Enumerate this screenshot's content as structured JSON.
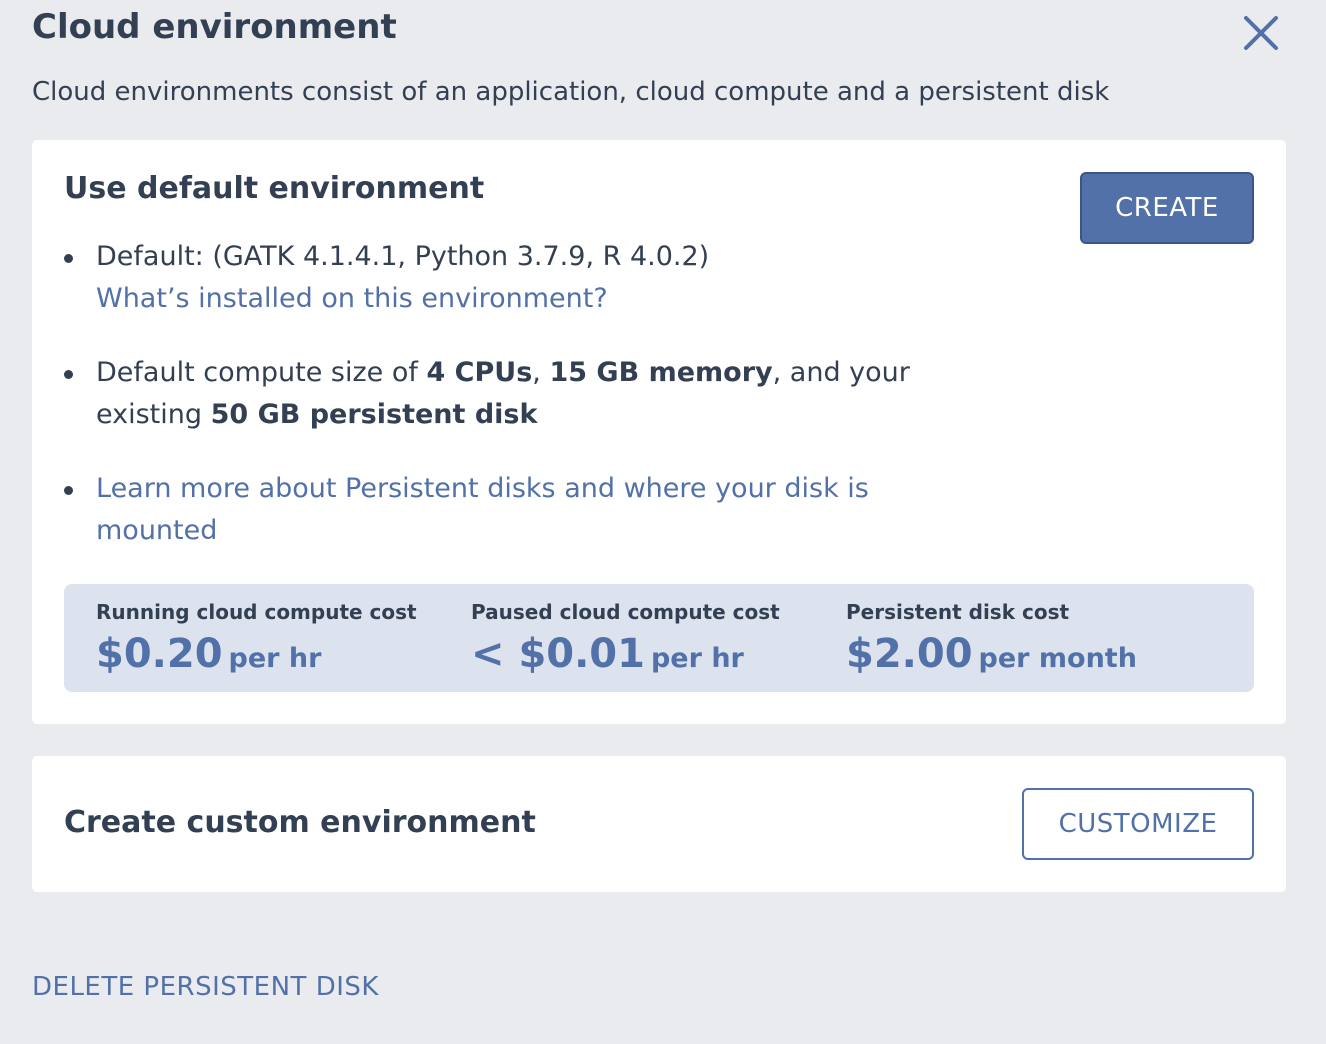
{
  "dialog": {
    "title": "Cloud environment",
    "subtitle": "Cloud environments consist of an application, cloud compute and a persistent disk"
  },
  "default_env": {
    "heading": "Use default environment",
    "create_label": "CREATE",
    "bullet1": {
      "text": "Default: (GATK 4.1.4.1, Python 3.7.9, R 4.0.2)",
      "link": "What’s installed on this environment?"
    },
    "bullet2": {
      "prefix": "Default compute size of ",
      "cpus": "4 CPUs",
      "sep1": ", ",
      "memory": "15 GB memory",
      "mid": ", and your existing ",
      "disk": "50 GB persistent disk"
    },
    "bullet3": {
      "link": "Learn more about Persistent disks and where your disk is mounted"
    },
    "costs": [
      {
        "label": "Running cloud compute cost",
        "amount": "$0.20",
        "unit": "per hr"
      },
      {
        "label": "Paused cloud compute cost",
        "amount": "< $0.01",
        "unit": "per hr"
      },
      {
        "label": "Persistent disk cost",
        "amount": "$2.00",
        "unit": "per month"
      }
    ]
  },
  "custom_env": {
    "heading": "Create custom environment",
    "customize_label": "CUSTOMIZE"
  },
  "footer": {
    "delete_label": "DELETE PERSISTENT DISK"
  },
  "colors": {
    "accent": "#5271a8",
    "background": "#e9ebee",
    "cost_box": "#dde3ee",
    "text": "#333f52"
  },
  "icons": {
    "close": "close-icon"
  }
}
